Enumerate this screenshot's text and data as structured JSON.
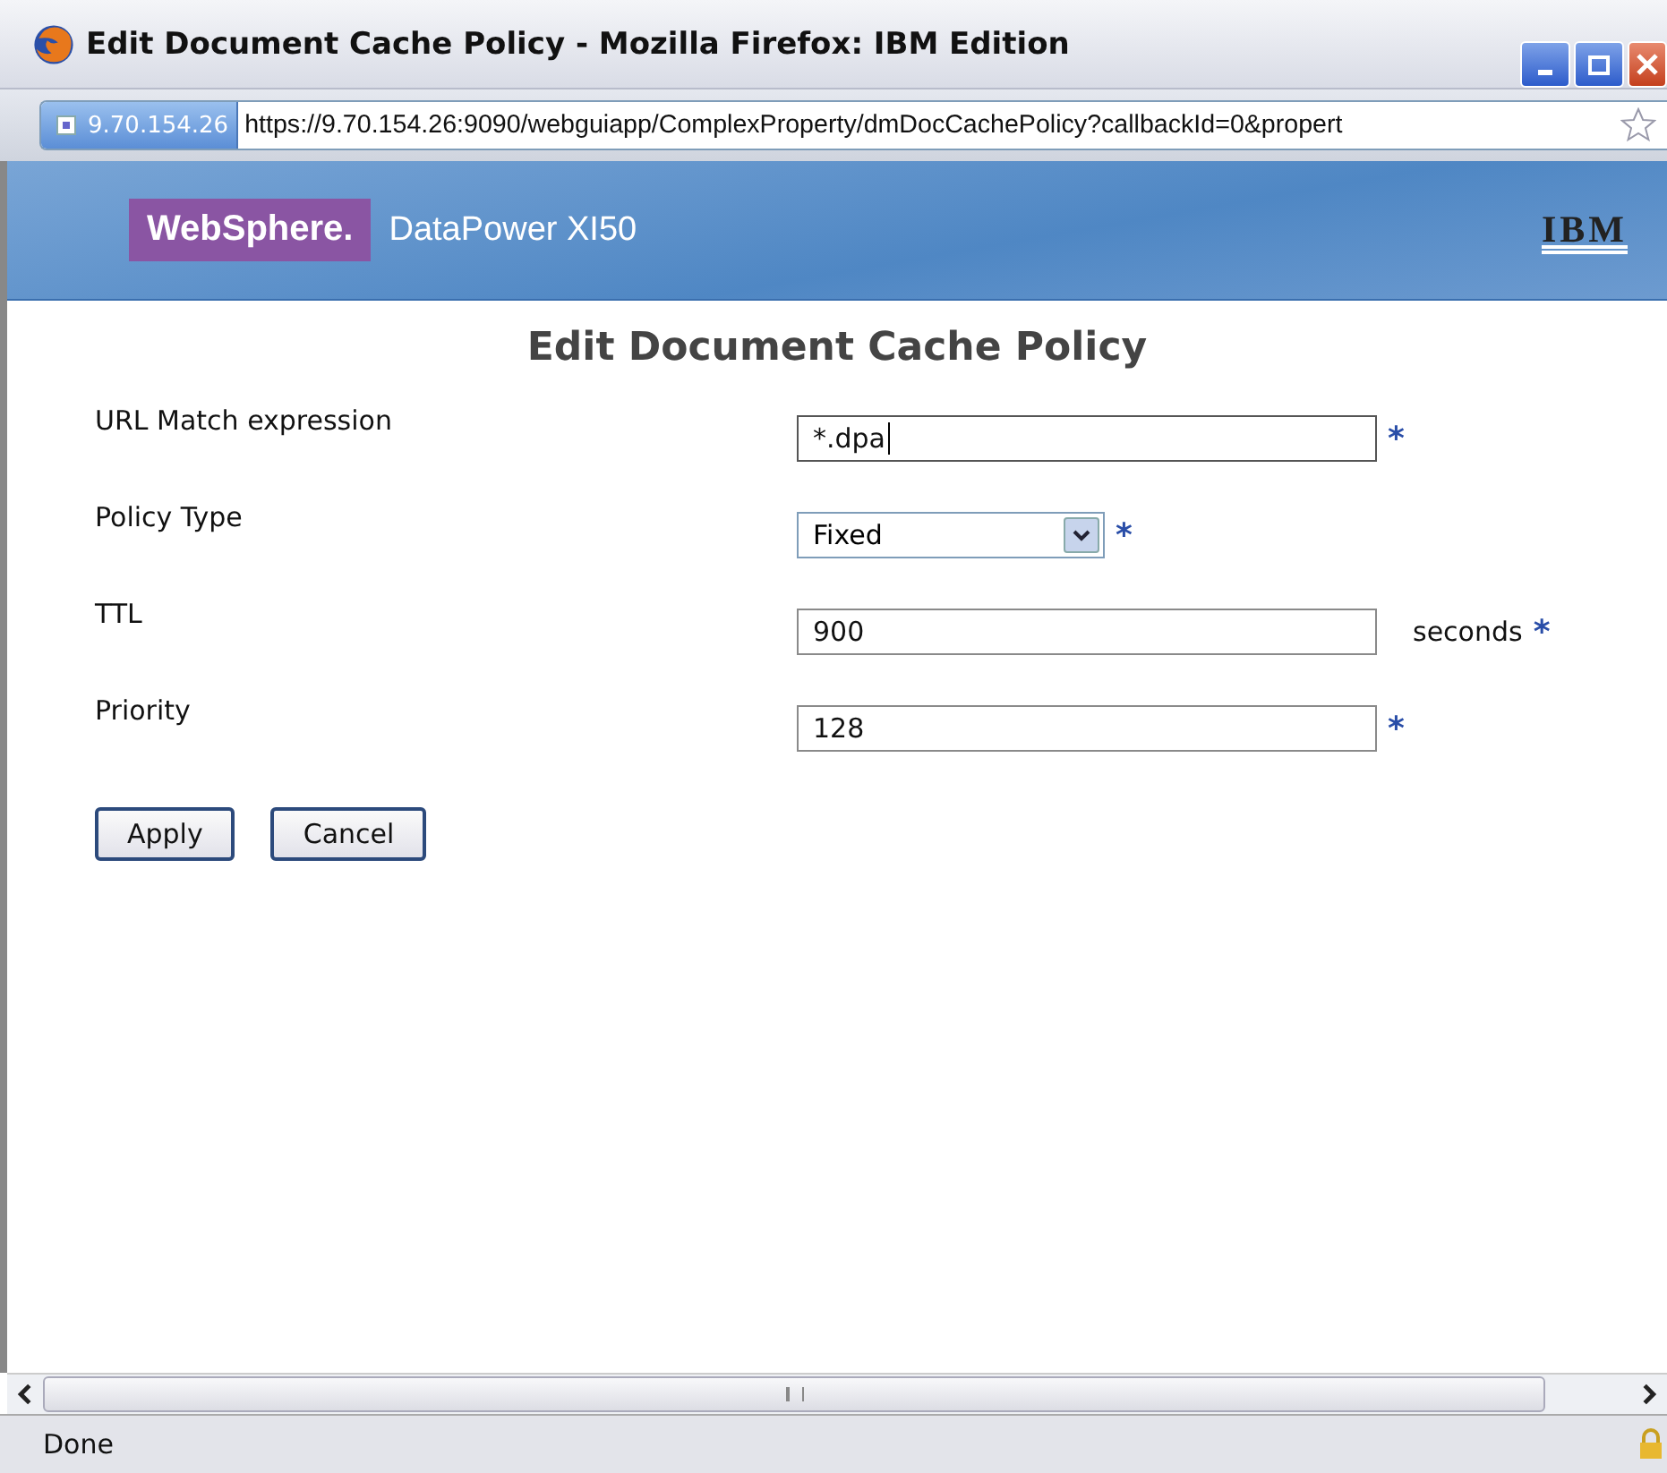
{
  "window": {
    "title": "Edit Document Cache Policy - Mozilla Firefox: IBM Edition"
  },
  "address_bar": {
    "site": "9.70.154.26",
    "url": "https://9.70.154.26:9090/webguiapp/ComplexProperty/dmDocCachePolicy?callbackId=0&propert"
  },
  "banner": {
    "brand": "WebSphere.",
    "product": "DataPower XI50",
    "vendor": "IBM"
  },
  "form": {
    "title": "Edit Document Cache Policy",
    "fields": [
      {
        "kind": "text",
        "label": "URL Match expression",
        "value": "*.dpa",
        "required": true,
        "focused": true
      },
      {
        "kind": "select",
        "label": "Policy Type",
        "value": "Fixed",
        "required": true
      },
      {
        "kind": "text",
        "label": "TTL",
        "value": "900",
        "unit": "seconds",
        "required": true,
        "focused": false
      },
      {
        "kind": "text",
        "label": "Priority",
        "value": "128",
        "required": true,
        "focused": false
      }
    ],
    "required_mark": "*",
    "buttons": [
      "Apply",
      "Cancel"
    ]
  },
  "status_bar": {
    "text": "Done"
  }
}
